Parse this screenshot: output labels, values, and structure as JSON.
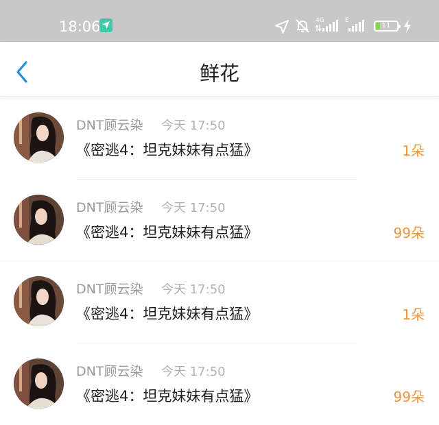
{
  "status_bar": {
    "time": "18:06",
    "network_label_1": "4G",
    "network_label_2": "E",
    "battery_level": "11",
    "icons": [
      "location-arrow-icon",
      "navigation-icon",
      "mute-bell-icon",
      "signal-icon",
      "battery-icon",
      "charging-icon"
    ]
  },
  "header": {
    "title": "鲜花",
    "back_icon": "chevron-left-icon"
  },
  "colors": {
    "accent": "#1a90e8",
    "count": "#f0953e",
    "status_bar_bg": "#c8c8c8"
  },
  "items": [
    {
      "user": "DNT顾云染",
      "time": "今天 17:50",
      "title": "《密逃4：坦克妹妹有点猛》",
      "count": "1朵"
    },
    {
      "user": "DNT顾云染",
      "time": "今天 17:50",
      "title": "《密逃4：坦克妹妹有点猛》",
      "count": "99朵"
    },
    {
      "user": "DNT顾云染",
      "time": "今天 17:50",
      "title": "《密逃4：坦克妹妹有点猛》",
      "count": "1朵"
    },
    {
      "user": "DNT顾云染",
      "time": "今天 17:50",
      "title": "《密逃4：坦克妹妹有点猛》",
      "count": "99朵"
    }
  ]
}
